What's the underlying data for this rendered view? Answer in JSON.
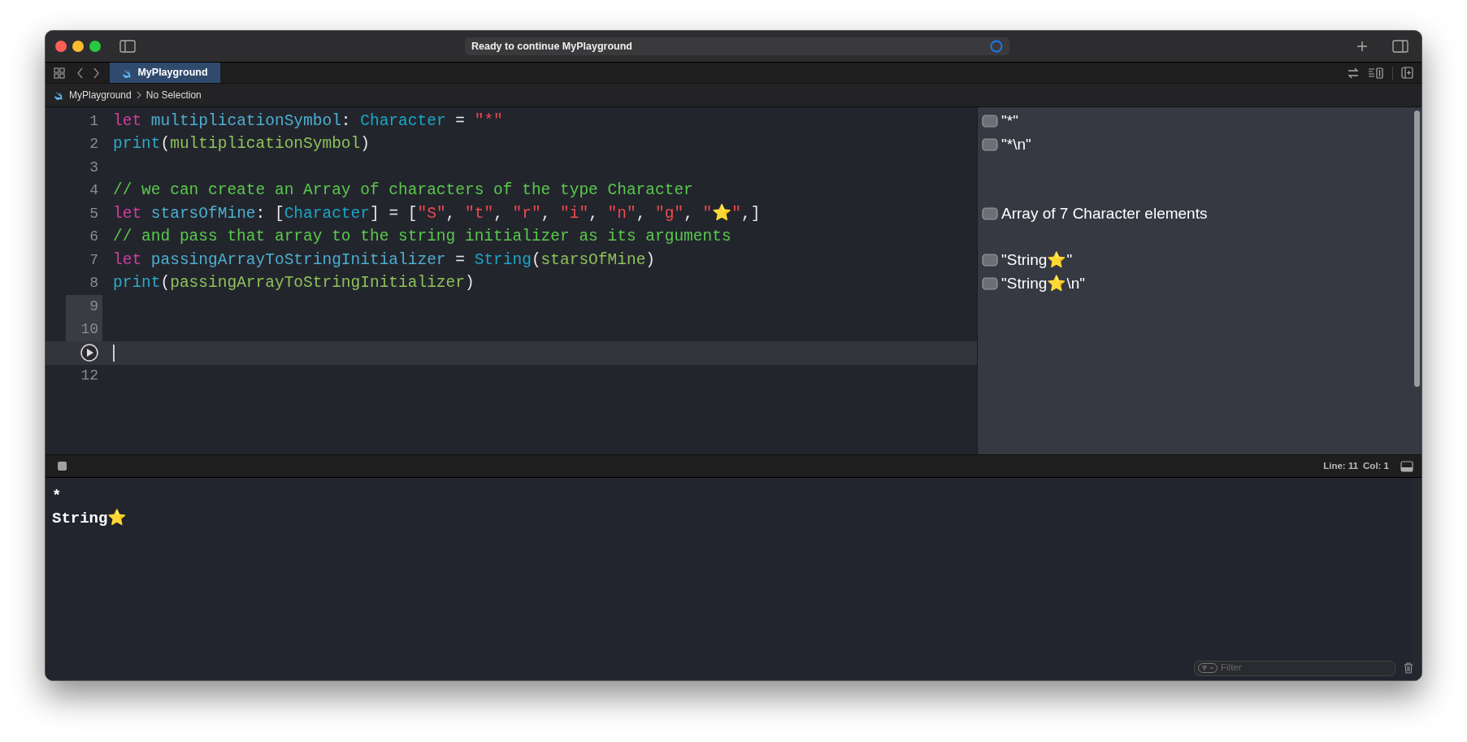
{
  "window": {
    "status": "Ready to continue MyPlayground"
  },
  "tabs": [
    {
      "label": "MyPlayground",
      "selected": true
    }
  ],
  "breadcrumb": [
    {
      "label": "MyPlayground"
    },
    {
      "label": "No Selection"
    }
  ],
  "lines": [
    {
      "number": "1",
      "marked": false,
      "current": false,
      "tokens": [
        {
          "kind": "keyword",
          "text": "let "
        },
        {
          "kind": "declaration",
          "text": "multiplicationSymbol"
        },
        {
          "kind": "plain",
          "text": ": "
        },
        {
          "kind": "type",
          "text": "Character"
        },
        {
          "kind": "plain",
          "text": " = "
        },
        {
          "kind": "string",
          "text": "\"*\""
        }
      ],
      "result": "\"*\""
    },
    {
      "number": "2",
      "marked": false,
      "current": false,
      "tokens": [
        {
          "kind": "function",
          "text": "print"
        },
        {
          "kind": "plain",
          "text": "("
        },
        {
          "kind": "identifier",
          "text": "multiplicationSymbol"
        },
        {
          "kind": "plain",
          "text": ")"
        }
      ],
      "result": "\"*\\n\""
    },
    {
      "number": "3",
      "marked": false,
      "current": false
    },
    {
      "number": "4",
      "marked": false,
      "current": false,
      "tokens": [
        {
          "kind": "comment",
          "text": "// we can create an Array of characters of the type Character"
        }
      ]
    },
    {
      "number": "5",
      "marked": false,
      "current": false,
      "tokens": [
        {
          "kind": "keyword",
          "text": "let "
        },
        {
          "kind": "declaration",
          "text": "starsOfMine"
        },
        {
          "kind": "plain",
          "text": ": ["
        },
        {
          "kind": "type",
          "text": "Character"
        },
        {
          "kind": "plain",
          "text": "] = ["
        },
        {
          "kind": "string",
          "text": "\"S\""
        },
        {
          "kind": "plain",
          "text": ", "
        },
        {
          "kind": "string",
          "text": "\"t\""
        },
        {
          "kind": "plain",
          "text": ", "
        },
        {
          "kind": "string",
          "text": "\"r\""
        },
        {
          "kind": "plain",
          "text": ", "
        },
        {
          "kind": "string",
          "text": "\"i\""
        },
        {
          "kind": "plain",
          "text": ", "
        },
        {
          "kind": "string",
          "text": "\"n\""
        },
        {
          "kind": "plain",
          "text": ", "
        },
        {
          "kind": "string",
          "text": "\"g\""
        },
        {
          "kind": "plain",
          "text": ", "
        },
        {
          "kind": "string",
          "text": "\"⭐\""
        },
        {
          "kind": "plain",
          "text": ",]"
        }
      ],
      "result": "Array of 7 Character elements"
    },
    {
      "number": "6",
      "marked": false,
      "current": false,
      "tokens": [
        {
          "kind": "comment",
          "text": "// and pass that array to the string initializer as its arguments"
        }
      ]
    },
    {
      "number": "7",
      "marked": false,
      "current": false,
      "tokens": [
        {
          "kind": "keyword",
          "text": "let "
        },
        {
          "kind": "declaration",
          "text": "passingArrayToStringInitializer"
        },
        {
          "kind": "plain",
          "text": " = "
        },
        {
          "kind": "type",
          "text": "String"
        },
        {
          "kind": "plain",
          "text": "("
        },
        {
          "kind": "identifier",
          "text": "starsOfMine"
        },
        {
          "kind": "plain",
          "text": ")"
        }
      ],
      "result": "\"String⭐\""
    },
    {
      "number": "8",
      "marked": false,
      "current": false,
      "tokens": [
        {
          "kind": "function",
          "text": "print"
        },
        {
          "kind": "plain",
          "text": "("
        },
        {
          "kind": "identifier",
          "text": "passingArrayToStringInitializer"
        },
        {
          "kind": "plain",
          "text": ")"
        }
      ],
      "result": "\"String⭐\\n\""
    },
    {
      "number": "9",
      "marked": true,
      "current": false
    },
    {
      "number": "10",
      "marked": true,
      "current": false
    },
    {
      "current": true,
      "marked": false
    },
    {
      "number": "12",
      "marked": false,
      "current": false
    }
  ],
  "debug_bar": {
    "line": "Line: 11",
    "column": "Col: 1"
  },
  "console": {
    "output": [
      "*",
      "String⭐"
    ],
    "filter": {
      "placeholder": "Filter"
    }
  }
}
